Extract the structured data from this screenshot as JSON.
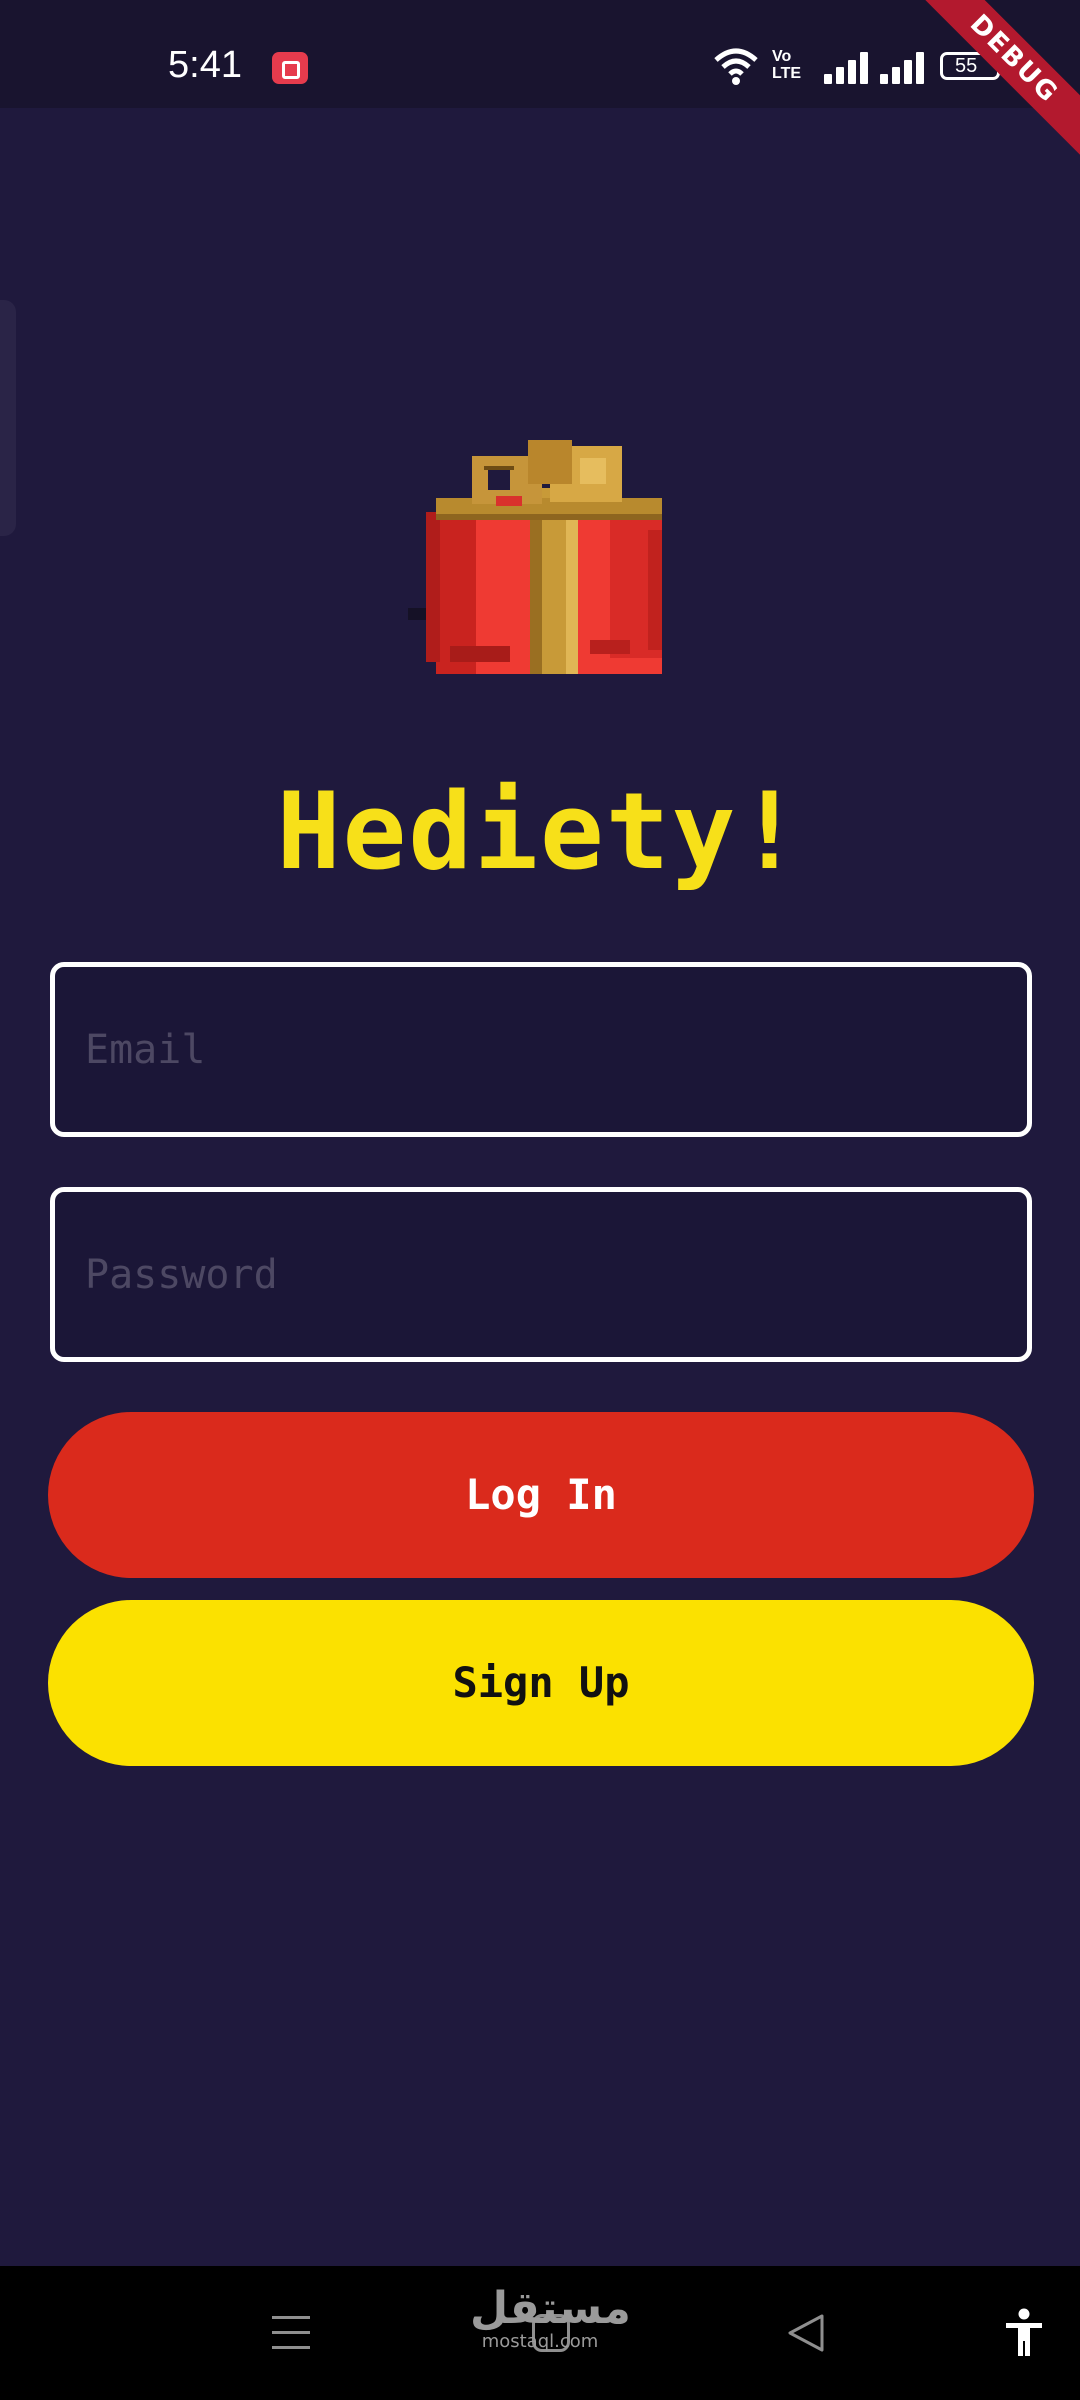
{
  "status_bar": {
    "time": "5:41",
    "volte": "Vo\nLTE",
    "battery": "55",
    "debug_label": "DEBUG"
  },
  "app": {
    "title": "Hediety!",
    "logo_icon": "gift-box-pixel-icon"
  },
  "form": {
    "email_placeholder": "Email",
    "password_placeholder": "Password",
    "login_label": "Log In",
    "signup_label": "Sign Up"
  },
  "nav_bar": {
    "watermark_arabic": "مستقل",
    "watermark_latin": "mostaql.com"
  },
  "colors": {
    "background": "#1f193d",
    "title": "#f7e019",
    "login_button": "#da2a1c",
    "signup_button": "#fbe100",
    "field_border": "#ffffff"
  }
}
